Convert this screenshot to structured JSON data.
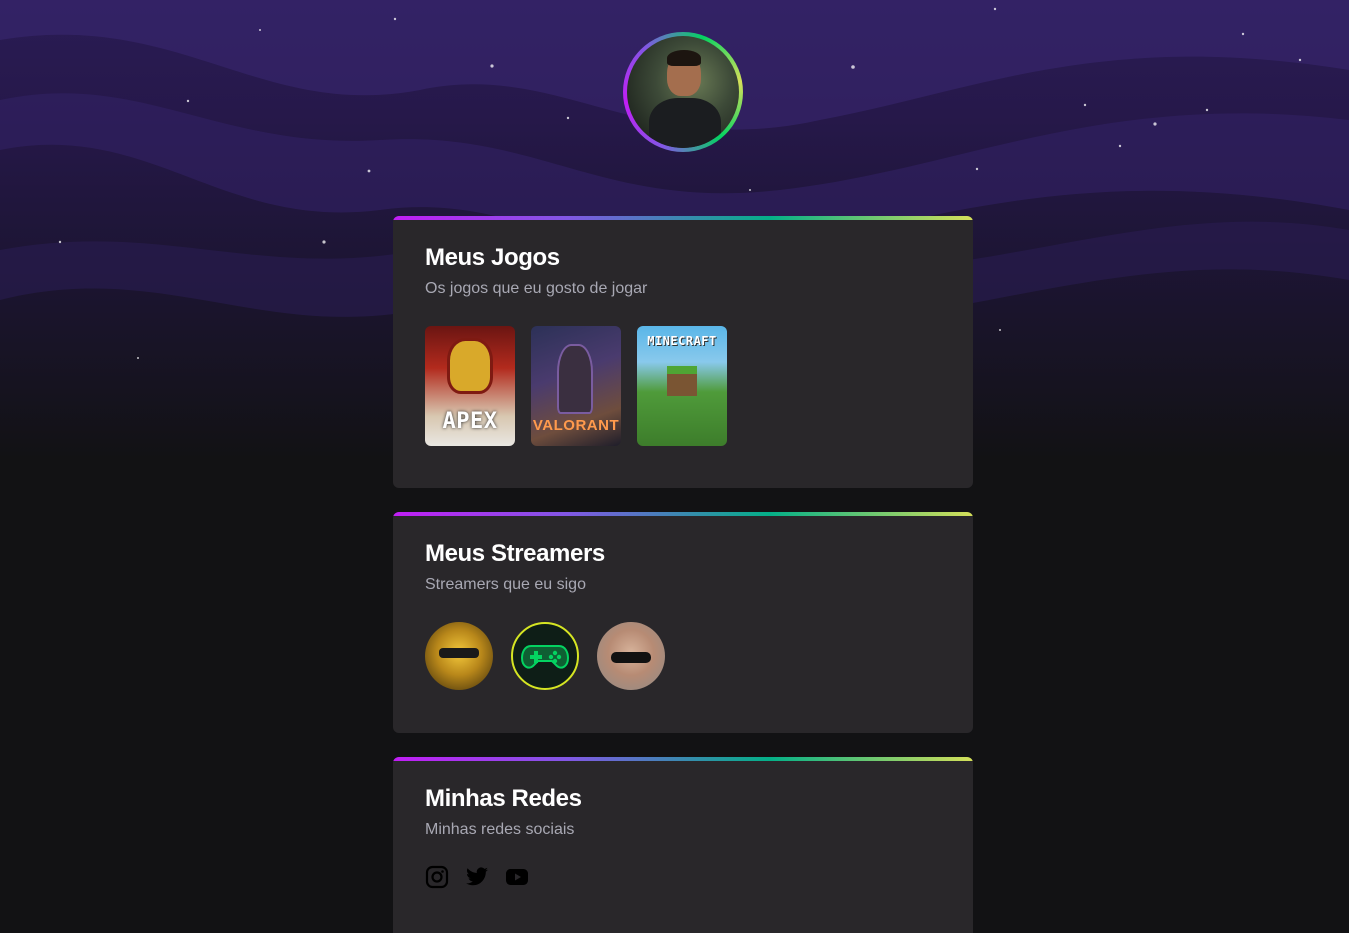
{
  "profile": {
    "avatar_icon": "profile-photo"
  },
  "sections": {
    "games": {
      "title": "Meus Jogos",
      "subtitle": "Os jogos que eu gosto de jogar",
      "items": [
        {
          "label": "APEX",
          "icon": "apex-legends-cover"
        },
        {
          "label": "VALORANT",
          "icon": "valorant-cover"
        },
        {
          "label": "MINECRAFT",
          "icon": "minecraft-cover"
        }
      ]
    },
    "streamers": {
      "title": "Meus Streamers",
      "subtitle": "Streamers que eu sigo",
      "items": [
        {
          "icon": "streamer-gold-avatar"
        },
        {
          "icon": "streamer-gamepad-avatar"
        },
        {
          "icon": "streamer-sunglasses-avatar"
        }
      ]
    },
    "socials": {
      "title": "Minhas Redes",
      "subtitle": "Minhas redes sociais",
      "items": [
        {
          "icon": "instagram-icon"
        },
        {
          "icon": "twitter-icon"
        },
        {
          "icon": "youtube-icon"
        }
      ]
    }
  },
  "colors": {
    "page_bg": "#121214",
    "card_bg": "#29272a",
    "gradient": [
      "#c11ef5",
      "#8257e5",
      "#04b088",
      "#d5e05a"
    ]
  }
}
